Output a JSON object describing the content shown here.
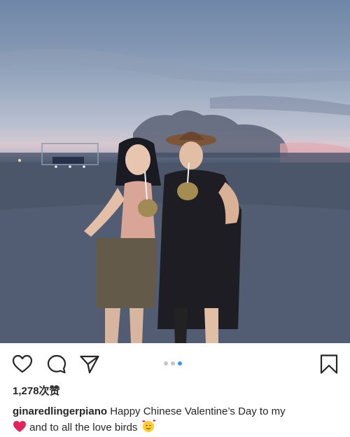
{
  "post": {
    "username": "ginaredlingerpiano",
    "likes_text": "1,278次赞",
    "caption_line1": "Happy Chinese Valentine’s Day to my",
    "caption_line2": "and to all the love birds",
    "carousel": {
      "count": 3,
      "active_index": 2
    }
  },
  "icons": {
    "like": "heart-outline-icon",
    "comment": "comment-bubble-icon",
    "share": "paper-plane-icon",
    "save": "bookmark-icon",
    "caption_emoji_1": "red-heart-emoji",
    "caption_emoji_2": "smiling-face-with-hearts-emoji"
  },
  "colors": {
    "text": "#262626",
    "carousel_active": "#3897f0",
    "carousel_inactive": "#c7c7c7",
    "heart_emoji": "#e0245e"
  }
}
